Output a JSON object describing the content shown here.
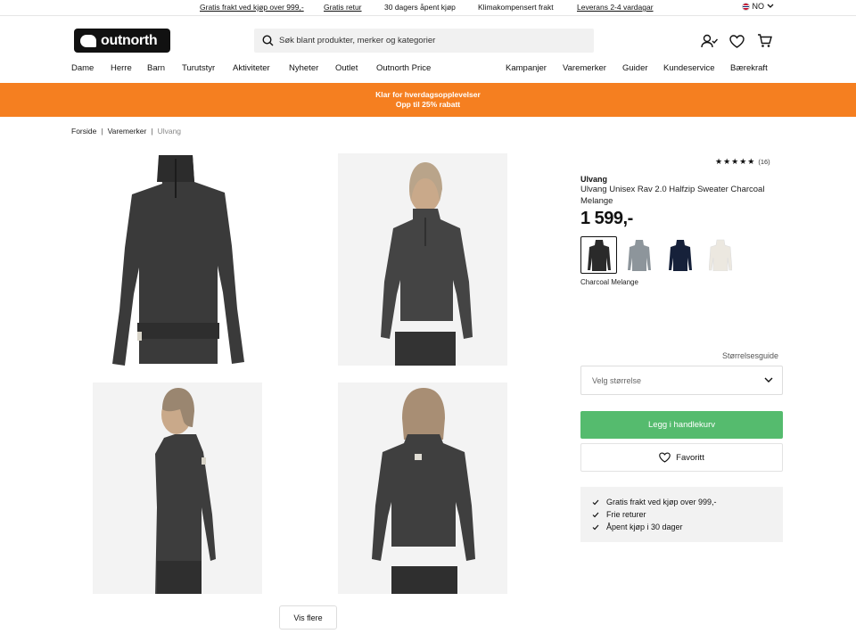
{
  "topbar": {
    "items": [
      "Gratis frakt ved kjøp over 999,-",
      "Gratis retur",
      "30 dagers åpent kjøp",
      "Klimakompensert frakt",
      "Leverans 2-4 vardagar"
    ],
    "language": "NO"
  },
  "header": {
    "logo_text": "outnorth",
    "search_placeholder": "Søk blant produkter, merker og kategorier",
    "icons": [
      "account-icon",
      "heart-icon",
      "cart-icon"
    ]
  },
  "nav": {
    "left": [
      "Dame",
      "Herre",
      "Barn",
      "Turutstyr",
      "Aktiviteter",
      "Nyheter",
      "Outlet",
      "Outnorth Price"
    ],
    "right": [
      "Kampanjer",
      "Varemerker",
      "Guider",
      "Kundeservice",
      "Bærekraft"
    ]
  },
  "banner": {
    "line1": "Klar for hverdagsopplevelser",
    "line2": "Opp til 25% rabatt",
    "color": "#f57f20"
  },
  "breadcrumb": [
    "Forside",
    "Varemerker",
    "Ulvang"
  ],
  "gallery": {
    "show_more_label": "Vis flere"
  },
  "product": {
    "rating_stars": 5,
    "rating_glyphs": "★★★★★",
    "review_count": "(16)",
    "brand": "Ulvang",
    "name": "Ulvang Unisex Rav 2.0 Halfzip Sweater Charcoal Melange",
    "price": "1 599,-",
    "selected_color": "Charcoal Melange",
    "swatch_colors": [
      "#2a2a2a",
      "#8d959b",
      "#16213a",
      "#ece8e0"
    ],
    "size_guide_label": "Størrelsesguide",
    "size_placeholder": "Velg størrelse",
    "add_to_cart_label": "Legg i handlekurv",
    "add_to_cart_color": "#55bb6e",
    "favorite_label": "Favoritt",
    "usps": [
      "Gratis frakt ved kjøp over 999,-",
      "Frie returer",
      "Åpent kjøp i 30 dager"
    ]
  }
}
